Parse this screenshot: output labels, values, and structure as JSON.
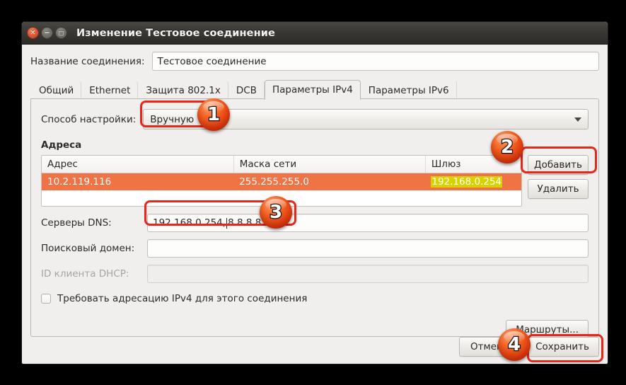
{
  "window": {
    "title": "Изменение Тестовое соединение",
    "controls": [
      {
        "name": "close",
        "glyph": "✕"
      },
      {
        "name": "minimize",
        "glyph": "−"
      },
      {
        "name": "maximize",
        "glyph": "□"
      }
    ]
  },
  "connection_name": {
    "label": "Название соединения:",
    "value": "Тестовое соединение"
  },
  "tabs": [
    {
      "label": "Общий",
      "active": false
    },
    {
      "label": "Ethernet",
      "active": false
    },
    {
      "label": "Защита 802.1x",
      "active": false
    },
    {
      "label": "DCB",
      "active": false
    },
    {
      "label": "Параметры IPv4",
      "active": true
    },
    {
      "label": "Параметры IPv6",
      "active": false
    }
  ],
  "method": {
    "label": "Способ настройки:",
    "value": "Вручную"
  },
  "addresses": {
    "section_title": "Адреса",
    "columns": [
      "Адрес",
      "Маска сети",
      "Шлюз"
    ],
    "rows": [
      {
        "address": "10.2.119.116",
        "netmask": "255.255.255.0",
        "gateway": "192.168.0.254",
        "selected": true,
        "gateway_highlighted": true
      }
    ],
    "add_button": "Добавить",
    "delete_button": "Удалить"
  },
  "dns": {
    "label": "Серверы DNS:",
    "value_before_caret": "192.168.0.254,",
    "value_after_caret": "8.8.8.8"
  },
  "search_domain": {
    "label": "Поисковый домен:",
    "value": ""
  },
  "dhcp_client_id": {
    "label": "ID клиента DHCP:",
    "value": "",
    "disabled": true
  },
  "require_ipv4": {
    "label": "Требовать адресацию IPv4 для этого соединения",
    "checked": false
  },
  "routes_button": "Маршруты...",
  "footer": {
    "cancel": "Отмена",
    "save": "Сохранить"
  },
  "annotations": {
    "badges": [
      {
        "number": "1",
        "target": "method-combobox"
      },
      {
        "number": "2",
        "target": "add-address-button"
      },
      {
        "number": "3",
        "target": "dns-servers-input"
      },
      {
        "number": "4",
        "target": "save-button"
      }
    ],
    "highlight_color": "#e8261a",
    "badge_color": "#e23c10",
    "selection_color": "#ef7345",
    "gateway_highlight_color": "#d8d200"
  }
}
